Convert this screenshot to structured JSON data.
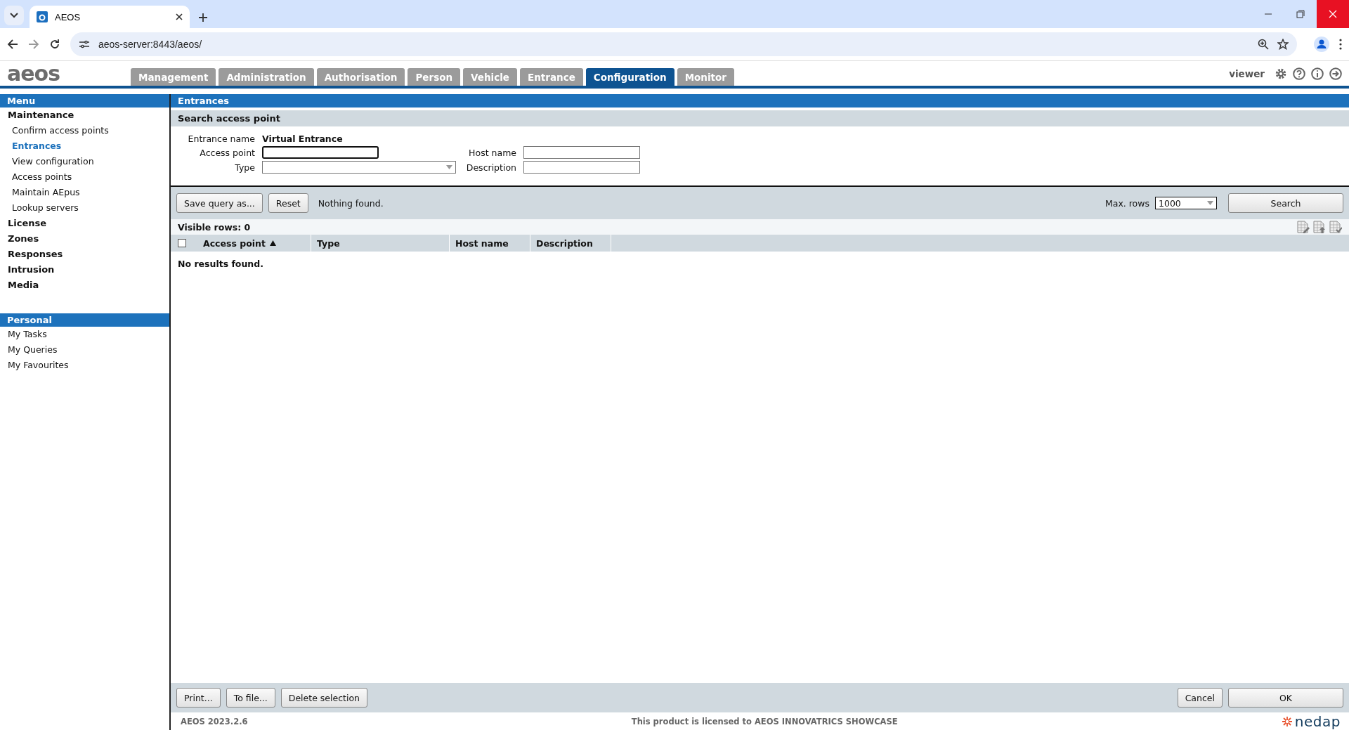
{
  "browser": {
    "tab_title": "AEOS",
    "url": "aeos-server:8443/aeos/"
  },
  "app": {
    "logo": "aeos",
    "user": "viewer",
    "nav_tabs": [
      {
        "label": "Management",
        "selected": false
      },
      {
        "label": "Administration",
        "selected": false
      },
      {
        "label": "Authorisation",
        "selected": false
      },
      {
        "label": "Person",
        "selected": false
      },
      {
        "label": "Vehicle",
        "selected": false
      },
      {
        "label": "Entrance",
        "selected": false
      },
      {
        "label": "Configuration",
        "selected": true
      },
      {
        "label": "Monitor",
        "selected": false
      }
    ]
  },
  "sidebar": {
    "menu": {
      "title": "Menu",
      "items": [
        {
          "label": "Maintenance",
          "selected": false,
          "children": [
            {
              "label": "Confirm access points",
              "selected": false
            },
            {
              "label": "Entrances",
              "selected": true
            },
            {
              "label": "View configuration",
              "selected": false
            },
            {
              "label": "Access points",
              "selected": false
            },
            {
              "label": "Maintain AEpus",
              "selected": false
            },
            {
              "label": "Lookup servers",
              "selected": false
            }
          ]
        },
        {
          "label": "License",
          "selected": false
        },
        {
          "label": "Zones",
          "selected": false
        },
        {
          "label": "Responses",
          "selected": false
        },
        {
          "label": "Intrusion",
          "selected": false
        },
        {
          "label": "Media",
          "selected": false
        }
      ]
    },
    "personal": {
      "title": "Personal",
      "items": [
        {
          "label": "My Tasks",
          "selected": false
        },
        {
          "label": "My Queries",
          "selected": false
        },
        {
          "label": "My Favourites",
          "selected": false
        }
      ]
    }
  },
  "panel": {
    "title": "Entrances",
    "subtitle": "Search access point",
    "form": {
      "entrance_name": {
        "label": "Entrance name",
        "value": "Virtual Entrance"
      },
      "access_point": {
        "label": "Access point",
        "focused": true
      },
      "type": {
        "label": "Type"
      },
      "host_name": {
        "label": "Host name"
      },
      "description": {
        "label": "Description"
      }
    },
    "toolbar": {
      "buttons": [
        "Save query as...",
        "Reset"
      ],
      "status": "Nothing found.",
      "max_rows_label": "Max. rows",
      "max_rows": "1000",
      "search_button": "Search"
    },
    "visible_rows": "Visible rows: 0",
    "table": {
      "select_all_checked": false,
      "columns": [
        {
          "label": "Access point",
          "sorted_ascending": true
        },
        {
          "label": "Type",
          "sorted_ascending": false
        },
        {
          "label": "Host name",
          "sorted_ascending": false
        },
        {
          "label": "Description",
          "sorted_ascending": false
        }
      ],
      "empty_message": "No results found."
    },
    "bottom_left_buttons": [
      "Print...",
      "To file...",
      "Delete selection"
    ],
    "bottom_right_buttons": [
      "Cancel",
      "OK"
    ]
  },
  "footer": {
    "version": "AEOS 2023.2.6",
    "license": "This product is licensed to AEOS INNOVATRICS SHOWCASE",
    "brand": "nedap"
  }
}
